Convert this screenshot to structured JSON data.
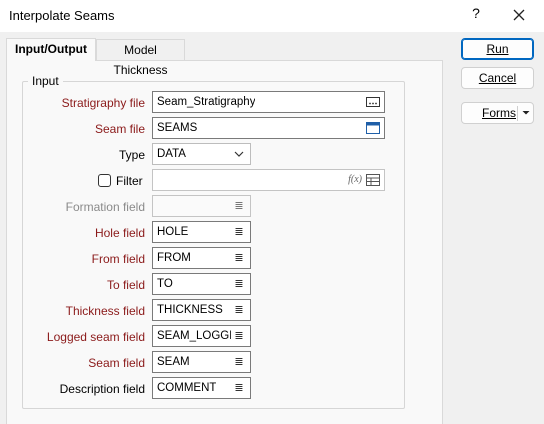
{
  "window": {
    "title": "Interpolate Seams",
    "help_glyph": "?"
  },
  "tabs": [
    {
      "label": "Input/Output",
      "active": true
    },
    {
      "label": "Model Thickness",
      "active": false
    }
  ],
  "group": {
    "title": "Input"
  },
  "fields": {
    "stratigraphy_file": {
      "label": "Stratigraphy file",
      "value": "Seam_Stratigraphy"
    },
    "seam_file": {
      "label": "Seam file",
      "value": "SEAMS"
    },
    "type": {
      "label": "Type",
      "value": "DATA"
    },
    "filter": {
      "label": "Filter",
      "value": "",
      "checked": false,
      "fx": "f(x)"
    },
    "formation_field": {
      "label": "Formation field",
      "value": ""
    },
    "hole_field": {
      "label": "Hole field",
      "value": "HOLE"
    },
    "from_field": {
      "label": "From field",
      "value": "FROM"
    },
    "to_field": {
      "label": "To field",
      "value": "TO"
    },
    "thickness_field": {
      "label": "Thickness field",
      "value": "THICKNESS"
    },
    "logged_seam_field": {
      "label": "Logged seam field",
      "value": "SEAM_LOGGED"
    },
    "seam_field": {
      "label": "Seam field",
      "value": "SEAM"
    },
    "description_field": {
      "label": "Description field",
      "value": "COMMENT"
    }
  },
  "buttons": {
    "run": "Run",
    "cancel": "Cancel",
    "forms": "Forms"
  },
  "colors": {
    "required_label": "#8b1a1a",
    "accent": "#0067c0"
  }
}
